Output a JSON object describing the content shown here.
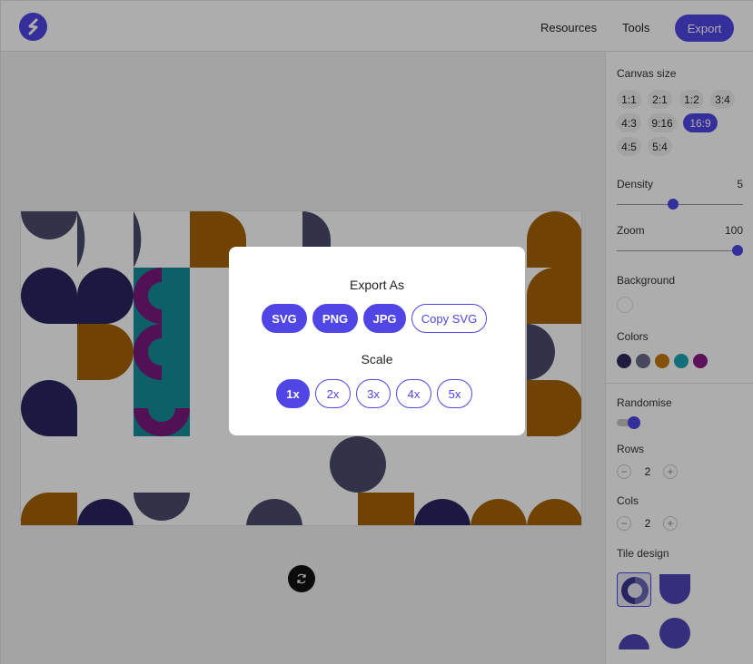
{
  "header": {
    "nav": [
      "Resources",
      "Tools"
    ],
    "export_label": "Export"
  },
  "sidebar": {
    "canvas_size_label": "Canvas size",
    "ratios": [
      "1:1",
      "2:1",
      "1:2",
      "3:4",
      "4:3",
      "9:16",
      "16:9",
      "4:5",
      "5:4"
    ],
    "selected_ratio": "16:9",
    "density_label": "Density",
    "density_value": "5",
    "zoom_label": "Zoom",
    "zoom_value": "100",
    "background_label": "Background",
    "colors_label": "Colors",
    "colors": [
      "#2d2a5e",
      "#6b6a8a",
      "#c47a10",
      "#1ba3b3",
      "#8a1a86"
    ],
    "randomise_label": "Randomise",
    "rows_label": "Rows",
    "rows_value": "2",
    "cols_label": "Cols",
    "cols_value": "2",
    "tile_design_label": "Tile design",
    "stepper_minus": "−",
    "stepper_plus": "+"
  },
  "modal": {
    "export_as_label": "Export As",
    "formats": [
      "SVG",
      "PNG",
      "JPG",
      "Copy SVG"
    ],
    "scale_label": "Scale",
    "scales": [
      "1x",
      "2x",
      "3x",
      "4x",
      "5x"
    ],
    "selected_scale": "1x"
  },
  "theme": {
    "accent": "#4f46e5",
    "navy": "#2d2a5e",
    "slate": "#6b6a8a",
    "orange": "#c47a10",
    "teal": "#1ba3b3",
    "purple": "#8a1a86"
  }
}
